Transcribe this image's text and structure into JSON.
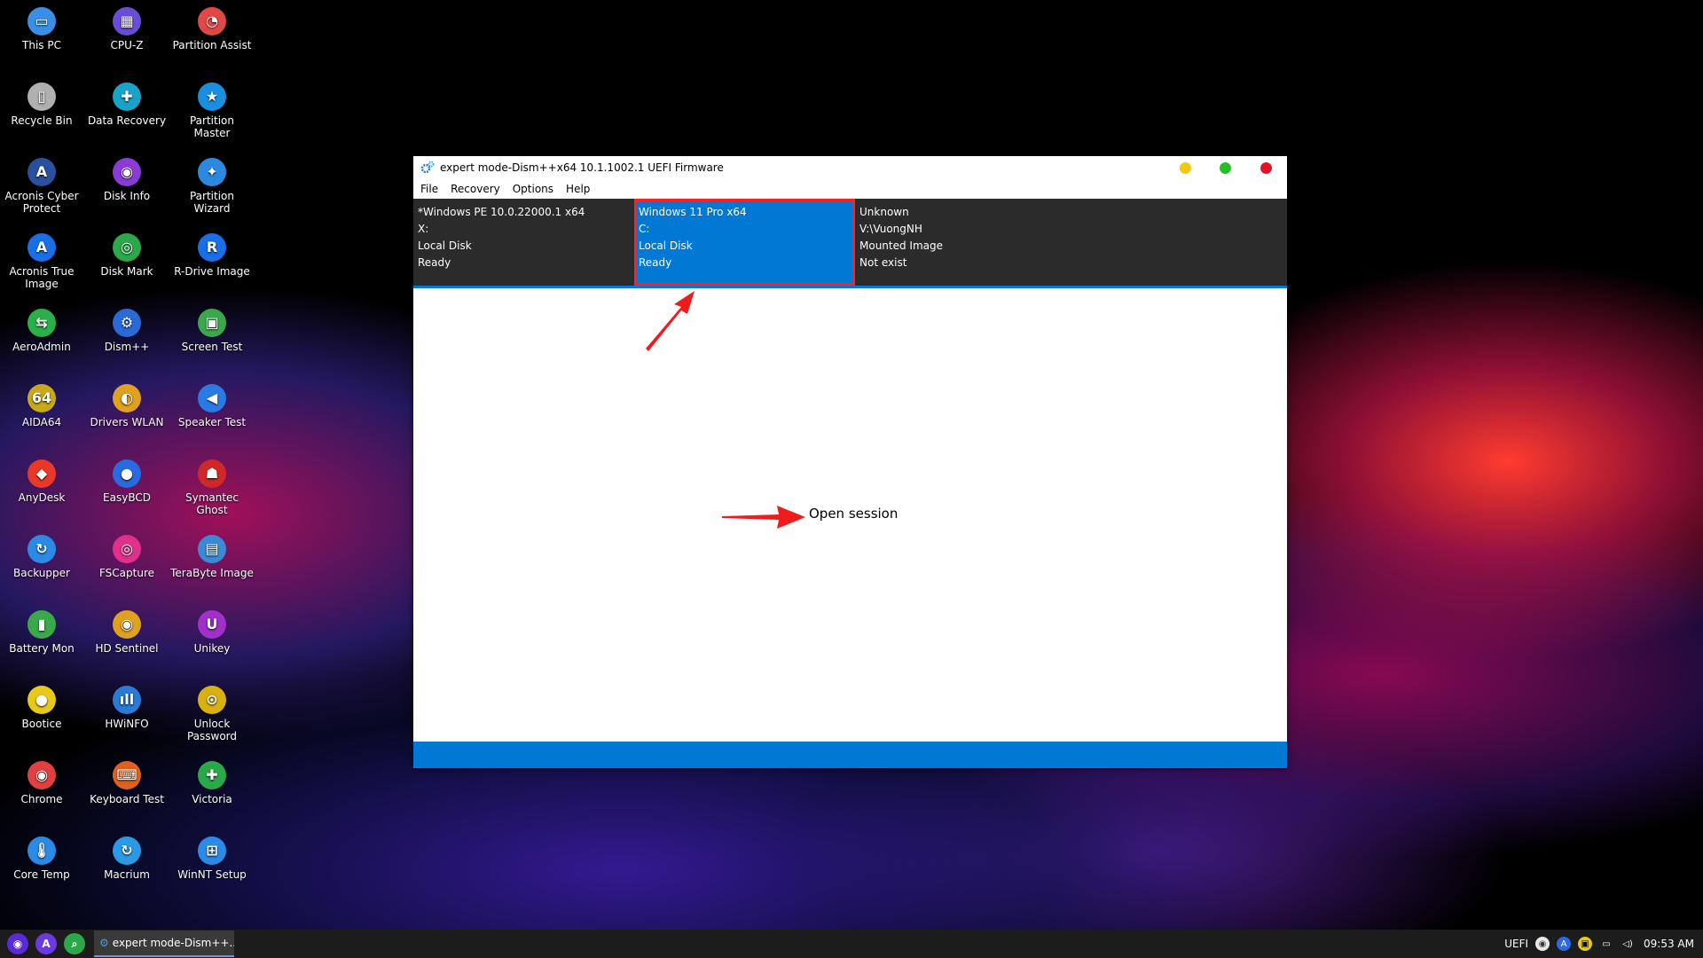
{
  "desktop": {
    "icons": [
      {
        "label": "This PC",
        "glyph": "▭",
        "color": "#3a8ee6"
      },
      {
        "label": "CPU-Z",
        "glyph": "▦",
        "color": "#6a4cd6"
      },
      {
        "label": "Partition Assist",
        "glyph": "◔",
        "color": "#e04848"
      },
      {
        "label": "Recycle Bin",
        "glyph": "▯",
        "color": "#b0b0b0"
      },
      {
        "label": "Data Recovery",
        "glyph": "✚",
        "color": "#1aa3c8"
      },
      {
        "label": "Partition Master",
        "glyph": "★",
        "color": "#1a8ee0"
      },
      {
        "label": "Acronis Cyber Protect",
        "glyph": "A",
        "color": "#2a4f9e"
      },
      {
        "label": "Disk Info",
        "glyph": "◉",
        "color": "#8a3ad6"
      },
      {
        "label": "Partition Wizard",
        "glyph": "✦",
        "color": "#2a8ae0"
      },
      {
        "label": "Acronis True Image",
        "glyph": "A",
        "color": "#1a6ee6"
      },
      {
        "label": "Disk Mark",
        "glyph": "◎",
        "color": "#2aa84a"
      },
      {
        "label": "R-Drive Image",
        "glyph": "R",
        "color": "#1a6ee6"
      },
      {
        "label": "AeroAdmin",
        "glyph": "⇆",
        "color": "#2ab04a"
      },
      {
        "label": "Dism++",
        "glyph": "⚙",
        "color": "#2a6ad6"
      },
      {
        "label": "Screen Test",
        "glyph": "▣",
        "color": "#3aa84a"
      },
      {
        "label": "AIDA64",
        "glyph": "64",
        "color": "#c8a818"
      },
      {
        "label": "Drivers WLAN",
        "glyph": "◐",
        "color": "#e0a020"
      },
      {
        "label": "Speaker Test",
        "glyph": "◀",
        "color": "#2a7ae6"
      },
      {
        "label": "AnyDesk",
        "glyph": "◆",
        "color": "#e8382a"
      },
      {
        "label": "EasyBCD",
        "glyph": "●",
        "color": "#2a6ae0"
      },
      {
        "label": "Symantec Ghost",
        "glyph": "☗",
        "color": "#d02828"
      },
      {
        "label": "Backupper",
        "glyph": "↻",
        "color": "#2a8ae6"
      },
      {
        "label": "FSCapture",
        "glyph": "◎",
        "color": "#e0308a"
      },
      {
        "label": "TeraByte Image",
        "glyph": "▤",
        "color": "#3a8ad6"
      },
      {
        "label": "Battery Mon",
        "glyph": "▮",
        "color": "#3aa84a"
      },
      {
        "label": "HD Sentinel",
        "glyph": "◉",
        "color": "#e0a020"
      },
      {
        "label": "Unikey",
        "glyph": "U",
        "color": "#a030c8"
      },
      {
        "label": "Bootice",
        "glyph": "●",
        "color": "#e8c818"
      },
      {
        "label": "HWiNFO",
        "glyph": "ıll",
        "color": "#2a7ad6"
      },
      {
        "label": "Unlock Password",
        "glyph": "⊙",
        "color": "#d8b010"
      },
      {
        "label": "Chrome",
        "glyph": "◉",
        "color": "#e04040"
      },
      {
        "label": "Keyboard Test",
        "glyph": "⌨",
        "color": "#e06020"
      },
      {
        "label": "Victoria",
        "glyph": "✚",
        "color": "#2aa84a"
      },
      {
        "label": "Core Temp",
        "glyph": "🌡",
        "color": "#2a8ae6"
      },
      {
        "label": "Macrium",
        "glyph": "↻",
        "color": "#2a9ae6"
      },
      {
        "label": "WinNT Setup",
        "glyph": "⊞",
        "color": "#2a8ae6"
      }
    ]
  },
  "window": {
    "title": "expert mode-Dism++x64 10.1.1002.1 UEFI Firmware",
    "menu": [
      "File",
      "Recovery",
      "Options",
      "Help"
    ],
    "sessions": [
      {
        "name": "*Windows PE 10.0.22000.1 x64",
        "drive": "X:",
        "type": "Local Disk",
        "status": "Ready"
      },
      {
        "name": "Windows 11 Pro x64",
        "drive": "C:",
        "type": "Local Disk",
        "status": "Ready"
      },
      {
        "name": "Unknown",
        "drive": "V:\\VuongNH",
        "type": "Mounted Image",
        "status": "Not exist"
      }
    ],
    "open_session": "Open session",
    "colors": {
      "accent": "#0078d4",
      "highlight": "#ff2020",
      "minimize": "#f2c811",
      "maximize": "#22c022",
      "close": "#e81123"
    }
  },
  "taskbar": {
    "task_label": "expert mode-Dism++...",
    "tray_text": "UEFI",
    "clock": "09:53 AM"
  }
}
